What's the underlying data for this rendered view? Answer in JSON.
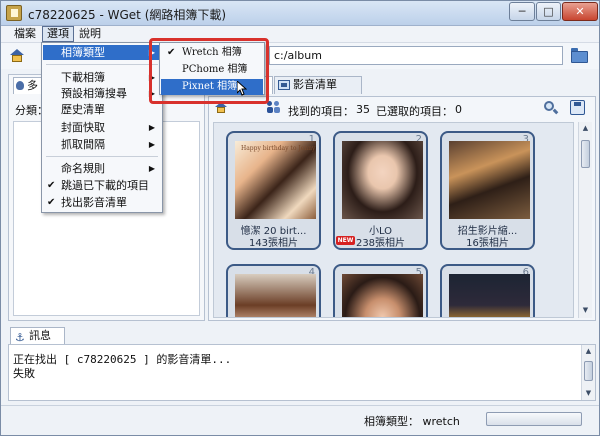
{
  "window": {
    "title": "c78220625 - WGet (網路相簿下載)",
    "minimize_label": "─",
    "maximize_label": "□",
    "close_label": "✕"
  },
  "menubar": {
    "file": "檔案",
    "options": "選項",
    "help": "說明"
  },
  "toolbar": {
    "path_label": ":",
    "path_value": "c:/album"
  },
  "left_panel": {
    "tab_label": "多",
    "category_label": "分類："
  },
  "main_tabs": {
    "album_tab": "相簿",
    "video_tab": "影音清單"
  },
  "content_toolbar": {
    "found_label": "找到的項目：",
    "found_count": "35",
    "selected_label": "已選取的項目：",
    "selected_count": "0"
  },
  "albums": [
    {
      "num": "1",
      "title": "憶潔 20 birt...",
      "count": "143張相片",
      "caption": "Happy birthday to Jenny"
    },
    {
      "num": "2",
      "title": "小LO",
      "count": "238張相片",
      "badge": "NEW"
    },
    {
      "num": "3",
      "title": "招生影片縮...",
      "count": "16張相片"
    },
    {
      "num": "4",
      "title": "",
      "count": ""
    },
    {
      "num": "5",
      "title": "",
      "count": ""
    },
    {
      "num": "6",
      "title": "",
      "count": ""
    }
  ],
  "options_menu": {
    "items": [
      {
        "label": "相簿類型",
        "arrow": "▶",
        "highlighted": true
      },
      {
        "label": "下載相簿",
        "arrow": "▶"
      },
      {
        "label": "預設相簿搜尋",
        "arrow": "▶"
      },
      {
        "label": "歷史清單"
      },
      {
        "label": "封面快取",
        "arrow": "▶"
      },
      {
        "label": "抓取間隔",
        "arrow": "▶"
      },
      {
        "label": "命名規則",
        "arrow": "▶"
      },
      {
        "label": "跳過已下載的項目",
        "checked": true
      },
      {
        "label": "找出影音清單",
        "checked": true
      }
    ],
    "check_mark": "✔"
  },
  "album_type_menu": {
    "items": [
      {
        "label": "Wretch 相簿",
        "checked": true
      },
      {
        "label": "PChome 相簿"
      },
      {
        "label": "Pixnet 相簿",
        "highlighted": true
      }
    ]
  },
  "log": {
    "tab_label": "訊息",
    "lines": [
      "正在找出 [ c78220625 ] 的影音清單...",
      "失敗"
    ]
  },
  "statusbar": {
    "album_type_label": "相簿類型： wretch"
  },
  "colors": {
    "accent_highlight": "#2f6ec9",
    "annotation_frame": "#d8312c",
    "card_border": "#3c5a86"
  }
}
